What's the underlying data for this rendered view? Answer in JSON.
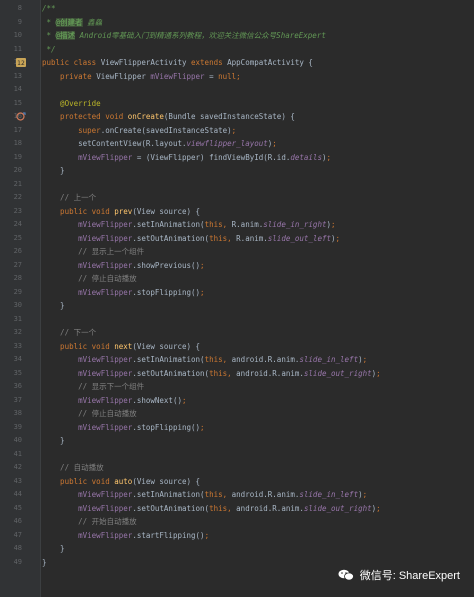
{
  "lines": [
    {
      "num": "8",
      "tokens": [
        {
          "t": "/**",
          "c": "doc"
        }
      ]
    },
    {
      "num": "9",
      "tokens": [
        {
          "t": " * ",
          "c": "doc"
        },
        {
          "t": "@创建者",
          "c": "doctag"
        },
        {
          "t": " 鑫鱻",
          "c": "doc"
        }
      ]
    },
    {
      "num": "10",
      "tokens": [
        {
          "t": " * ",
          "c": "doc"
        },
        {
          "t": "@描述",
          "c": "doctag"
        },
        {
          "t": " Android零基础入门到精通系列教程，欢迎关注微信公众号ShareExpert",
          "c": "doc"
        }
      ]
    },
    {
      "num": "11",
      "tokens": [
        {
          "t": " */",
          "c": "doc"
        }
      ]
    },
    {
      "num": "12",
      "marker": "class",
      "tokens": [
        {
          "t": "public class ",
          "c": "kw"
        },
        {
          "t": "ViewFlipperActivity ",
          "c": "plain"
        },
        {
          "t": "extends ",
          "c": "kw"
        },
        {
          "t": "AppCompatActivity {",
          "c": "plain"
        }
      ]
    },
    {
      "num": "13",
      "tokens": [
        {
          "t": "    private ",
          "c": "kw"
        },
        {
          "t": "ViewFlipper ",
          "c": "plain"
        },
        {
          "t": "mViewFlipper",
          "c": "field"
        },
        {
          "t": " = ",
          "c": "plain"
        },
        {
          "t": "null",
          "c": "kw"
        },
        {
          "t": ";",
          "c": "kw"
        }
      ]
    },
    {
      "num": "14",
      "tokens": []
    },
    {
      "num": "15",
      "tokens": [
        {
          "t": "    @Override",
          "c": "anno"
        }
      ]
    },
    {
      "num": "16",
      "marker": "override",
      "tokens": [
        {
          "t": "    protected void ",
          "c": "kw"
        },
        {
          "t": "onCreate",
          "c": "method"
        },
        {
          "t": "(Bundle savedInstanceState) {",
          "c": "plain"
        }
      ]
    },
    {
      "num": "17",
      "tokens": [
        {
          "t": "        super",
          "c": "kw"
        },
        {
          "t": ".onCreate(savedInstanceState)",
          "c": "plain"
        },
        {
          "t": ";",
          "c": "kw"
        }
      ]
    },
    {
      "num": "18",
      "tokens": [
        {
          "t": "        setContentView(R.layout.",
          "c": "plain"
        },
        {
          "t": "viewflipper_layout",
          "c": "italic"
        },
        {
          "t": ")",
          "c": "plain"
        },
        {
          "t": ";",
          "c": "kw"
        }
      ]
    },
    {
      "num": "19",
      "tokens": [
        {
          "t": "        ",
          "c": "plain"
        },
        {
          "t": "mViewFlipper",
          "c": "field"
        },
        {
          "t": " = (ViewFlipper) findViewById(R.id.",
          "c": "plain"
        },
        {
          "t": "details",
          "c": "italic"
        },
        {
          "t": ")",
          "c": "plain"
        },
        {
          "t": ";",
          "c": "kw"
        }
      ]
    },
    {
      "num": "20",
      "tokens": [
        {
          "t": "    }",
          "c": "plain"
        }
      ]
    },
    {
      "num": "21",
      "tokens": []
    },
    {
      "num": "22",
      "tokens": [
        {
          "t": "    // 上一个",
          "c": "comment"
        }
      ]
    },
    {
      "num": "23",
      "tokens": [
        {
          "t": "    public void ",
          "c": "kw"
        },
        {
          "t": "prev",
          "c": "method"
        },
        {
          "t": "(View source) {",
          "c": "plain"
        }
      ]
    },
    {
      "num": "24",
      "tokens": [
        {
          "t": "        ",
          "c": "plain"
        },
        {
          "t": "mViewFlipper",
          "c": "field"
        },
        {
          "t": ".setInAnimation(",
          "c": "plain"
        },
        {
          "t": "this, ",
          "c": "kw"
        },
        {
          "t": "R.anim.",
          "c": "plain"
        },
        {
          "t": "slide_in_right",
          "c": "italic"
        },
        {
          "t": ")",
          "c": "plain"
        },
        {
          "t": ";",
          "c": "kw"
        }
      ]
    },
    {
      "num": "25",
      "tokens": [
        {
          "t": "        ",
          "c": "plain"
        },
        {
          "t": "mViewFlipper",
          "c": "field"
        },
        {
          "t": ".setOutAnimation(",
          "c": "plain"
        },
        {
          "t": "this, ",
          "c": "kw"
        },
        {
          "t": "R.anim.",
          "c": "plain"
        },
        {
          "t": "slide_out_left",
          "c": "italic"
        },
        {
          "t": ")",
          "c": "plain"
        },
        {
          "t": ";",
          "c": "kw"
        }
      ]
    },
    {
      "num": "26",
      "tokens": [
        {
          "t": "        // 显示上一个组件",
          "c": "comment"
        }
      ]
    },
    {
      "num": "27",
      "tokens": [
        {
          "t": "        ",
          "c": "plain"
        },
        {
          "t": "mViewFlipper",
          "c": "field"
        },
        {
          "t": ".showPrevious()",
          "c": "plain"
        },
        {
          "t": ";",
          "c": "kw"
        }
      ]
    },
    {
      "num": "28",
      "tokens": [
        {
          "t": "        // 停止自动播放",
          "c": "comment"
        }
      ]
    },
    {
      "num": "29",
      "tokens": [
        {
          "t": "        ",
          "c": "plain"
        },
        {
          "t": "mViewFlipper",
          "c": "field"
        },
        {
          "t": ".stopFlipping()",
          "c": "plain"
        },
        {
          "t": ";",
          "c": "kw"
        }
      ]
    },
    {
      "num": "30",
      "tokens": [
        {
          "t": "    }",
          "c": "plain"
        }
      ]
    },
    {
      "num": "31",
      "tokens": []
    },
    {
      "num": "32",
      "tokens": [
        {
          "t": "    // 下一个",
          "c": "comment"
        }
      ]
    },
    {
      "num": "33",
      "tokens": [
        {
          "t": "    public void ",
          "c": "kw"
        },
        {
          "t": "next",
          "c": "method"
        },
        {
          "t": "(View source) {",
          "c": "plain"
        }
      ]
    },
    {
      "num": "34",
      "tokens": [
        {
          "t": "        ",
          "c": "plain"
        },
        {
          "t": "mViewFlipper",
          "c": "field"
        },
        {
          "t": ".setInAnimation(",
          "c": "plain"
        },
        {
          "t": "this, ",
          "c": "kw"
        },
        {
          "t": "android.R.anim.",
          "c": "plain"
        },
        {
          "t": "slide_in_left",
          "c": "italic"
        },
        {
          "t": ")",
          "c": "plain"
        },
        {
          "t": ";",
          "c": "kw"
        }
      ]
    },
    {
      "num": "35",
      "tokens": [
        {
          "t": "        ",
          "c": "plain"
        },
        {
          "t": "mViewFlipper",
          "c": "field"
        },
        {
          "t": ".setOutAnimation(",
          "c": "plain"
        },
        {
          "t": "this, ",
          "c": "kw"
        },
        {
          "t": "android.R.anim.",
          "c": "plain"
        },
        {
          "t": "slide_out_right",
          "c": "italic"
        },
        {
          "t": ")",
          "c": "plain"
        },
        {
          "t": ";",
          "c": "kw"
        }
      ]
    },
    {
      "num": "36",
      "tokens": [
        {
          "t": "        // 显示下一个组件",
          "c": "comment"
        }
      ]
    },
    {
      "num": "37",
      "tokens": [
        {
          "t": "        ",
          "c": "plain"
        },
        {
          "t": "mViewFlipper",
          "c": "field"
        },
        {
          "t": ".showNext()",
          "c": "plain"
        },
        {
          "t": ";",
          "c": "kw"
        }
      ]
    },
    {
      "num": "38",
      "tokens": [
        {
          "t": "        // 停止自动播放",
          "c": "comment"
        }
      ]
    },
    {
      "num": "39",
      "tokens": [
        {
          "t": "        ",
          "c": "plain"
        },
        {
          "t": "mViewFlipper",
          "c": "field"
        },
        {
          "t": ".stopFlipping()",
          "c": "plain"
        },
        {
          "t": ";",
          "c": "kw"
        }
      ]
    },
    {
      "num": "40",
      "tokens": [
        {
          "t": "    }",
          "c": "plain"
        }
      ]
    },
    {
      "num": "41",
      "tokens": []
    },
    {
      "num": "42",
      "tokens": [
        {
          "t": "    // 自动播放",
          "c": "comment"
        }
      ]
    },
    {
      "num": "43",
      "tokens": [
        {
          "t": "    public void ",
          "c": "kw"
        },
        {
          "t": "auto",
          "c": "method"
        },
        {
          "t": "(View source) {",
          "c": "plain"
        }
      ]
    },
    {
      "num": "44",
      "tokens": [
        {
          "t": "        ",
          "c": "plain"
        },
        {
          "t": "mViewFlipper",
          "c": "field"
        },
        {
          "t": ".setInAnimation(",
          "c": "plain"
        },
        {
          "t": "this, ",
          "c": "kw"
        },
        {
          "t": "android.R.anim.",
          "c": "plain"
        },
        {
          "t": "slide_in_left",
          "c": "italic"
        },
        {
          "t": ")",
          "c": "plain"
        },
        {
          "t": ";",
          "c": "kw"
        }
      ]
    },
    {
      "num": "45",
      "tokens": [
        {
          "t": "        ",
          "c": "plain"
        },
        {
          "t": "mViewFlipper",
          "c": "field"
        },
        {
          "t": ".setOutAnimation(",
          "c": "plain"
        },
        {
          "t": "this, ",
          "c": "kw"
        },
        {
          "t": "android.R.anim.",
          "c": "plain"
        },
        {
          "t": "slide_out_right",
          "c": "italic"
        },
        {
          "t": ")",
          "c": "plain"
        },
        {
          "t": ";",
          "c": "kw"
        }
      ]
    },
    {
      "num": "46",
      "tokens": [
        {
          "t": "        // 开始自动播放",
          "c": "comment"
        }
      ]
    },
    {
      "num": "47",
      "tokens": [
        {
          "t": "        ",
          "c": "plain"
        },
        {
          "t": "mViewFlipper",
          "c": "field"
        },
        {
          "t": ".startFlipping()",
          "c": "plain"
        },
        {
          "t": ";",
          "c": "kw"
        }
      ]
    },
    {
      "num": "48",
      "tokens": [
        {
          "t": "    }",
          "c": "plain"
        }
      ]
    },
    {
      "num": "49",
      "tokens": [
        {
          "t": "}",
          "c": "plain"
        }
      ]
    }
  ],
  "watermark": {
    "text": "微信号: ShareExpert",
    "icon": "wechat-icon"
  },
  "colors": {
    "background": "#2b2b2b",
    "gutter": "#313335",
    "keyword": "#cc7832",
    "method": "#ffc66d",
    "field": "#9876aa",
    "comment": "#808080",
    "doc": "#629755",
    "plain": "#a9b7c6"
  }
}
